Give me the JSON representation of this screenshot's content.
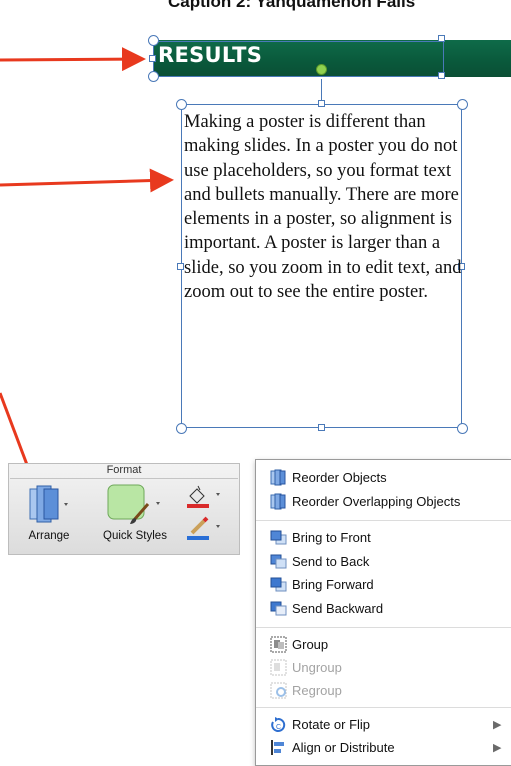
{
  "caption": "Caption 2: Yanquamenon Falls",
  "results_header": "RESULTS",
  "body_text": "Making a poster is different than making slides. In a poster you do not use placeholders, so you format text and bullets manually. There are more elements in a poster, so alignment is important. A poster is larger than a slide, so you zoom in to edit text, and zoom out to see the entire poster.",
  "ribbon": {
    "group_title": "Format",
    "arrange_label": "Arrange",
    "quick_styles_label": "Quick Styles"
  },
  "menu": {
    "items": [
      {
        "label": "Reorder Objects",
        "icon": "reorder-objects-icon",
        "enabled": true
      },
      {
        "label": "Reorder Overlapping Objects",
        "icon": "reorder-overlapping-icon",
        "enabled": true
      },
      {
        "label": "Bring to Front",
        "icon": "bring-to-front-icon",
        "enabled": true
      },
      {
        "label": "Send to Back",
        "icon": "send-to-back-icon",
        "enabled": true
      },
      {
        "label": "Bring Forward",
        "icon": "bring-forward-icon",
        "enabled": true
      },
      {
        "label": "Send Backward",
        "icon": "send-backward-icon",
        "enabled": true
      },
      {
        "label": "Group",
        "icon": "group-icon",
        "enabled": true
      },
      {
        "label": "Ungroup",
        "icon": "ungroup-icon",
        "enabled": false
      },
      {
        "label": "Regroup",
        "icon": "regroup-icon",
        "enabled": false
      },
      {
        "label": "Rotate or Flip",
        "icon": "rotate-flip-icon",
        "enabled": true,
        "submenu": true
      },
      {
        "label": "Align or Distribute",
        "icon": "align-distribute-icon",
        "enabled": true,
        "submenu": true
      }
    ]
  },
  "colors": {
    "results_bar": "#0b5d3f",
    "selection": "#4a79b8",
    "annotation_arrow": "#e8391e",
    "fill_accent": "#d92b2b",
    "line_accent": "#2a6fd6"
  }
}
